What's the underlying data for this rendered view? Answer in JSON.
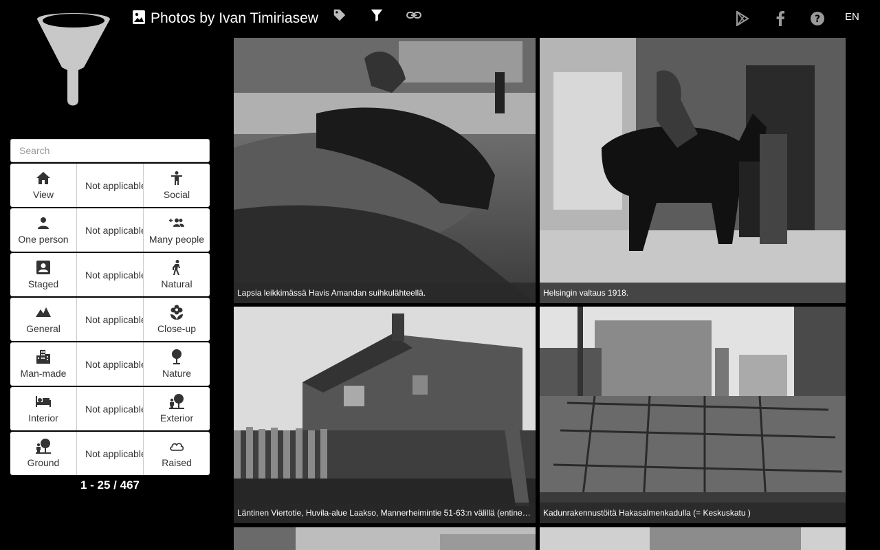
{
  "header": {
    "title": "Photos by Ivan Timiriasew",
    "icons": [
      "photo-icon",
      "tag-icon",
      "filter-icon",
      "link-icon",
      "google-play-icon",
      "facebook-icon",
      "help-icon"
    ],
    "language": "EN"
  },
  "search": {
    "placeholder": "Search",
    "value": ""
  },
  "filters": [
    {
      "left": "View",
      "left_icon": "home-icon",
      "middle": "Not applicable",
      "right": "Social",
      "right_icon": "person-standing-icon"
    },
    {
      "left": "One person",
      "left_icon": "person-icon",
      "middle": "Not applicable",
      "right": "Many people",
      "right_icon": "group-add-icon"
    },
    {
      "left": "Staged",
      "left_icon": "portrait-icon",
      "middle": "Not applicable",
      "right": "Natural",
      "right_icon": "walking-icon"
    },
    {
      "left": "General",
      "left_icon": "landscape-icon",
      "middle": "Not applicable",
      "right": "Close-up",
      "right_icon": "flower-icon"
    },
    {
      "left": "Man-made",
      "left_icon": "city-icon",
      "middle": "Not applicable",
      "right": "Nature",
      "right_icon": "tree-icon"
    },
    {
      "left": "Interior",
      "left_icon": "bed-icon",
      "middle": "Not applicable",
      "right": "Exterior",
      "right_icon": "nature-person-icon"
    },
    {
      "left": "Ground",
      "left_icon": "nature-person-icon",
      "middle": "Not applicable",
      "right": "Raised",
      "right_icon": "cloud-icon"
    }
  ],
  "pagination": {
    "label": "1 - 25 / 467"
  },
  "photos": [
    {
      "caption": "Lapsia leikkimässä Havis Amandan suihkulähteellä."
    },
    {
      "caption": "Helsingin valtaus 1918."
    },
    {
      "caption": "Läntinen Viertotie, Huvila-alue Laakso, Mannerheimintie 51-63:n välillä (entinen Läntinen Viertotie)"
    },
    {
      "caption": "Kadunrakennustöitä Hakasalmenkadulla (= Keskuskatu )"
    },
    {
      "caption": ""
    },
    {
      "caption": ""
    }
  ],
  "colors": {
    "background": "#000000",
    "caption_bg": "#282828",
    "panel": "#ffffff",
    "logo": "#c8c8c8"
  }
}
